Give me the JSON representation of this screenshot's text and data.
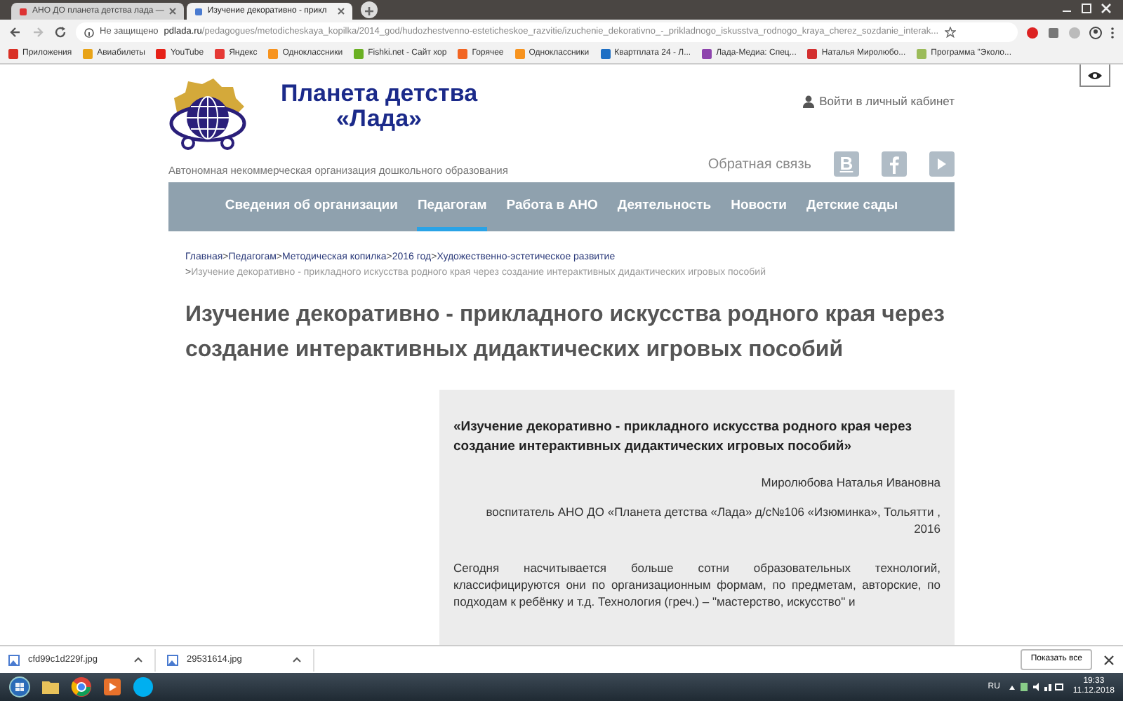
{
  "browser": {
    "tabs": [
      {
        "title": "АНО ДО планета детства лада —",
        "selected": false
      },
      {
        "title": "Изучение декоративно - прикл",
        "selected": true
      }
    ],
    "security": "Не защищено",
    "url_domain": "pdlada.ru",
    "url_path": "/pedagogues/metodicheskaya_kopilka/2014_god/hudozhestvenno-esteticheskoe_razvitie/izuchenie_dekorativno_-_prikladnogo_iskusstva_rodnogo_kraya_cherez_sozdanie_interak...",
    "bookmarks": [
      {
        "label": "Приложения",
        "color": "#d93025"
      },
      {
        "label": "Авиабилеты",
        "color": "#e8a317"
      },
      {
        "label": "YouTube",
        "color": "#e62117"
      },
      {
        "label": "Яндекс",
        "color": "#e53935"
      },
      {
        "label": "Одноклассники",
        "color": "#f7931e"
      },
      {
        "label": "Fishki.net - Сайт хор",
        "color": "#6ab023"
      },
      {
        "label": "Горячее",
        "color": "#f26522"
      },
      {
        "label": "Одноклассники",
        "color": "#f7931e"
      },
      {
        "label": "Квартплата 24 - Л...",
        "color": "#1e6fc4"
      },
      {
        "label": "Лада-Медиа: Спец...",
        "color": "#8e44ad"
      },
      {
        "label": "Наталья Миролюбо...",
        "color": "#d32f2f"
      },
      {
        "label": "Программа \"Эколо...",
        "color": "#9bbb59"
      }
    ]
  },
  "site": {
    "logo_title_1": "Планета детства",
    "logo_title_2": "«Лада»",
    "tagline": "Автономная некоммерческая организация дошкольного образования",
    "login": "Войти в личный кабинет",
    "feedback": "Обратная связь",
    "social": [
      "В"
    ],
    "nav": [
      {
        "label": "Сведения об организации",
        "selected": false
      },
      {
        "label": "Педагогам",
        "selected": true
      },
      {
        "label": "Работа в АНО",
        "selected": false
      },
      {
        "label": "Деятельность",
        "selected": false
      },
      {
        "label": "Новости",
        "selected": false
      },
      {
        "label": "Детские сады",
        "selected": false
      }
    ],
    "breadcrumb": [
      "Главная",
      "Педагогам",
      "Методическая копилка",
      "2016 год",
      "Художественно-эстетическое развитие"
    ],
    "separator": ">",
    "current": "Изучение декоративно - прикладного искусства родного края через создание интерактивных дидактических игровых пособий",
    "heading": "Изучение декоративно - прикладного искусства родного края через создание интерактивных дидактических игровых пособий",
    "article": {
      "title": "«Изучение декоративно - прикладного искусства родного края через создание интерактивных дидактических игровых пособий»",
      "author": "Миролюбова Наталья Ивановна",
      "position": "воспитатель АНО ДО «Планета детства «Лада» д/с№106 «Изюминка», Тольятти , 2016",
      "paragraph": "Сегодня насчитывается больше сотни образовательных технологий, классифицируются  они по организационным формам, по предметам, авторские, по подходам к ребёнку и т.д.  Технология (греч.) –  \"мастерство, искусство\" и"
    }
  },
  "downloads": {
    "files": [
      "cfd99c1d229f.jpg",
      "29531614.jpg"
    ],
    "show_all": "Показать все"
  },
  "taskbar": {
    "language": "RU",
    "time": "19:33",
    "date": "11.12.2018"
  }
}
